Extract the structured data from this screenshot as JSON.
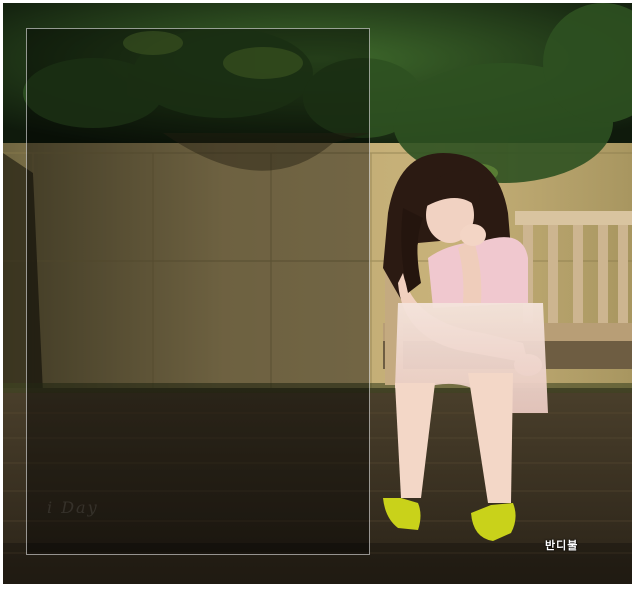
{
  "photo": {
    "subject": "",
    "signature": "반디불",
    "overlay_ghost_title": "i Day",
    "overlay_ghost_lines": [
      "",
      ""
    ]
  }
}
